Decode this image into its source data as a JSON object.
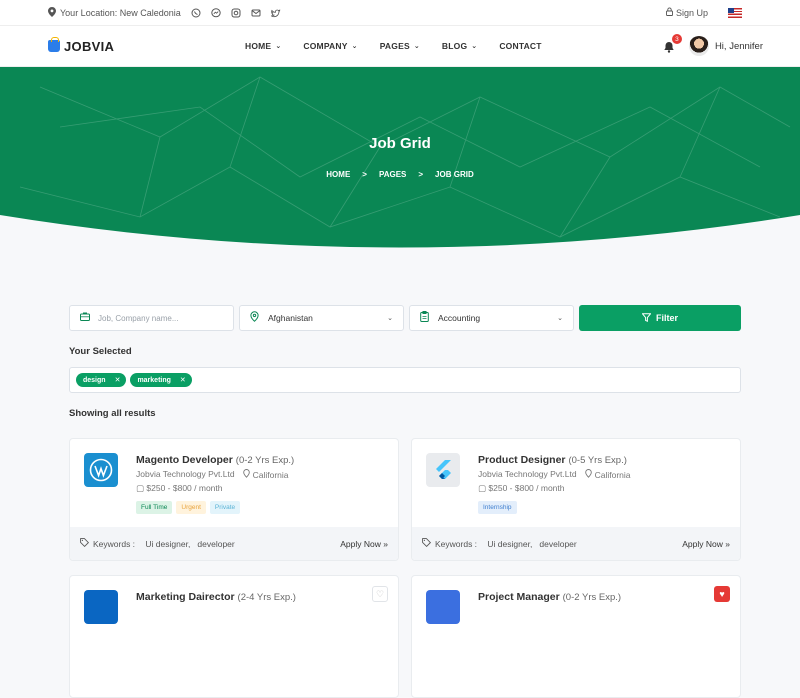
{
  "topbar": {
    "location": "Your Location: New Caledonia",
    "socials": [
      "whatsapp-icon",
      "messenger-icon",
      "instagram-icon",
      "mail-icon",
      "twitter-icon"
    ],
    "signup": "Sign Up"
  },
  "nav": {
    "brand": "JOBVIA",
    "menu": [
      {
        "label": "HOME",
        "dropdown": true
      },
      {
        "label": "COMPANY",
        "dropdown": true
      },
      {
        "label": "PAGES",
        "dropdown": true
      },
      {
        "label": "BLOG",
        "dropdown": true
      },
      {
        "label": "CONTACT",
        "dropdown": false
      }
    ],
    "notifications": "3",
    "greeting": "Hi, Jennifer"
  },
  "hero": {
    "title": "Job Grid",
    "crumbs": [
      "HOME",
      "PAGES",
      "JOB GRID"
    ],
    "sep": ">"
  },
  "search": {
    "keyword_placeholder": "Job, Company name...",
    "location": "Afghanistan",
    "category": "Accounting",
    "filter_label": "Filter"
  },
  "selected": {
    "label": "Your Selected",
    "tags": [
      "design",
      "marketing"
    ]
  },
  "results_label": "Showing all results",
  "colors": {
    "brand": "#0a8754",
    "accent": "#0a9f64"
  },
  "jobs": [
    {
      "title": "Magento Developer",
      "exp": "(0-2 Yrs Exp.)",
      "company": "Jobvia Technology Pvt.Ltd",
      "location": "California",
      "salary": "$250 - $800 / month",
      "badges": [
        "Full Time",
        "Urgent",
        "Private"
      ],
      "keywords_label": "Keywords :",
      "keywords": "Ui designer,   developer",
      "apply": "Apply Now"
    },
    {
      "title": "Product Designer",
      "exp": "(0-5 Yrs Exp.)",
      "company": "Jobvia Technology Pvt.Ltd",
      "location": "California",
      "salary": "$250 - $800 / month",
      "badges": [
        "Internship"
      ],
      "keywords_label": "Keywords :",
      "keywords": "Ui designer,   developer",
      "apply": "Apply Now"
    },
    {
      "title": "Marketing Dairector",
      "exp": "(2-4 Yrs Exp.)"
    },
    {
      "title": "Project Manager",
      "exp": "(0-2 Yrs Exp.)"
    }
  ]
}
